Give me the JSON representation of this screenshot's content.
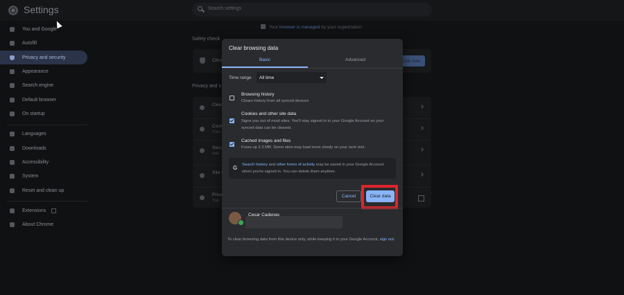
{
  "app": {
    "title": "Settings"
  },
  "search": {
    "placeholder": "Search settings"
  },
  "sidebar": {
    "items": [
      {
        "label": "You and Google"
      },
      {
        "label": "Autofill"
      },
      {
        "label": "Privacy and security",
        "active": true
      },
      {
        "label": "Appearance"
      },
      {
        "label": "Search engine"
      },
      {
        "label": "Default browser"
      },
      {
        "label": "On startup"
      },
      {
        "label": "Languages"
      },
      {
        "label": "Downloads"
      },
      {
        "label": "Accessibility"
      },
      {
        "label": "System"
      },
      {
        "label": "Reset and clean up"
      },
      {
        "label": "Extensions"
      },
      {
        "label": "About Chrome"
      }
    ]
  },
  "managed": {
    "prefix": "Your",
    "link": "browser is managed",
    "suffix": "by your organization"
  },
  "main": {
    "safety_check_label": "Safety check",
    "safety_row_text": "Chro",
    "check_now_label": "eck now",
    "privacy_label": "Privacy and s",
    "rows": [
      {
        "title": "Clea",
        "sub": ""
      },
      {
        "title": "Cook",
        "sub": "Third"
      },
      {
        "title": "Secu",
        "sub": "Safe"
      },
      {
        "title": "Site S",
        "sub": ""
      },
      {
        "title": "Priva",
        "sub": "Trial"
      }
    ]
  },
  "dialog": {
    "title": "Clear browsing data",
    "tabs": {
      "basic": "Basic",
      "advanced": "Advanced"
    },
    "time_range": {
      "label": "Time range",
      "value": "All time"
    },
    "options": [
      {
        "title": "Browsing history",
        "desc": "Clears history from all synced devices",
        "checked": false
      },
      {
        "title": "Cookies and other site data",
        "desc": "Signs you out of most sites. You'll stay signed in to your Google Account so your synced data can be cleared.",
        "checked": true
      },
      {
        "title": "Cached images and files",
        "desc": "Frees up 2.3 MB. Some sites may load more slowly on your next visit.",
        "checked": true
      }
    ],
    "google_note": {
      "link1": "Search history",
      "mid": " and ",
      "link2": "other forms of activity",
      "rest": " may be saved in your Google Account when you're signed in. You can delete them anytime."
    },
    "buttons": {
      "cancel": "Cancel",
      "clear": "Clear data"
    },
    "user": {
      "name": "Cesar Cadenas"
    },
    "footer": {
      "text": "To clear browsing data from this device only, while keeping it in your Google Account, ",
      "link": "sign out."
    },
    "colors": {
      "accent": "#8ab4f8",
      "highlight": "#e2242c"
    }
  }
}
